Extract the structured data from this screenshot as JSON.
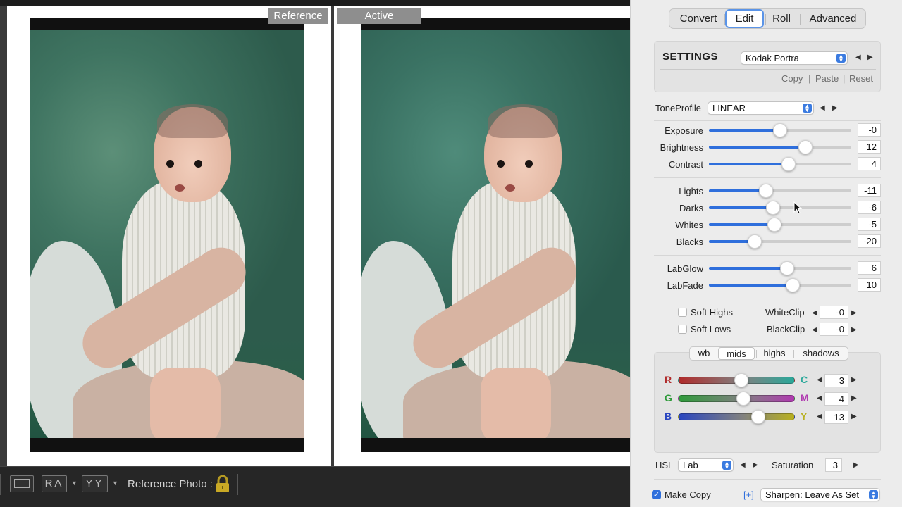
{
  "compare": {
    "reference_label": "Reference",
    "active_label": "Active"
  },
  "bottom_bar": {
    "ra_button": "RA",
    "yy_button": "YY",
    "reference_photo_label": "Reference Photo :"
  },
  "tabs": [
    {
      "label": "Convert"
    },
    {
      "label": "Edit"
    },
    {
      "label": "Roll"
    },
    {
      "label": "Advanced"
    }
  ],
  "settings": {
    "title": "SETTINGS",
    "preset": "Kodak Portra",
    "copy": "Copy",
    "paste": "Paste",
    "reset": "Reset",
    "separator": "|"
  },
  "tone_profile": {
    "label": "ToneProfile",
    "value": "LINEAR"
  },
  "sliders": [
    {
      "label": "Exposure",
      "value": "-0",
      "position": 0.5
    },
    {
      "label": "Brightness",
      "value": "12",
      "position": 0.68
    },
    {
      "label": "Contrast",
      "value": "4",
      "position": 0.56
    },
    {
      "label": "Lights",
      "value": "-11",
      "position": 0.4
    },
    {
      "label": "Darks",
      "value": "-6",
      "position": 0.45
    },
    {
      "label": "Whites",
      "value": "-5",
      "position": 0.46
    },
    {
      "label": "Blacks",
      "value": "-20",
      "position": 0.32
    },
    {
      "label": "LabGlow",
      "value": "6",
      "position": 0.55
    },
    {
      "label": "LabFade",
      "value": "10",
      "position": 0.59
    }
  ],
  "clip": {
    "soft_highs": "Soft Highs",
    "soft_lows": "Soft Lows",
    "white_clip_label": "WhiteClip",
    "white_clip_value": "-0",
    "black_clip_label": "BlackClip",
    "black_clip_value": "-0"
  },
  "color_tabs": [
    {
      "label": "wb"
    },
    {
      "label": "mids"
    },
    {
      "label": "highs"
    },
    {
      "label": "shadows"
    }
  ],
  "color_balance": [
    {
      "left": "R",
      "right": "C",
      "value": "3",
      "position": 0.54,
      "left_color": "#b02a2a",
      "right_color": "#2aa89a"
    },
    {
      "left": "G",
      "right": "M",
      "value": "4",
      "position": 0.56,
      "left_color": "#2e9a3a",
      "right_color": "#b03ab0"
    },
    {
      "left": "B",
      "right": "Y",
      "value": "13",
      "position": 0.69,
      "left_color": "#2a46c0",
      "right_color": "#b8b020"
    }
  ],
  "hsl": {
    "label": "HSL",
    "mode": "Lab",
    "saturation_label": "Saturation",
    "saturation_value": "3"
  },
  "footer": {
    "make_copy": "Make Copy",
    "plus": "[+]",
    "sharpen": "Sharpen: Leave As Set"
  },
  "colors": {
    "accent": "#2f6fdc",
    "panel_bg": "#ececec"
  }
}
